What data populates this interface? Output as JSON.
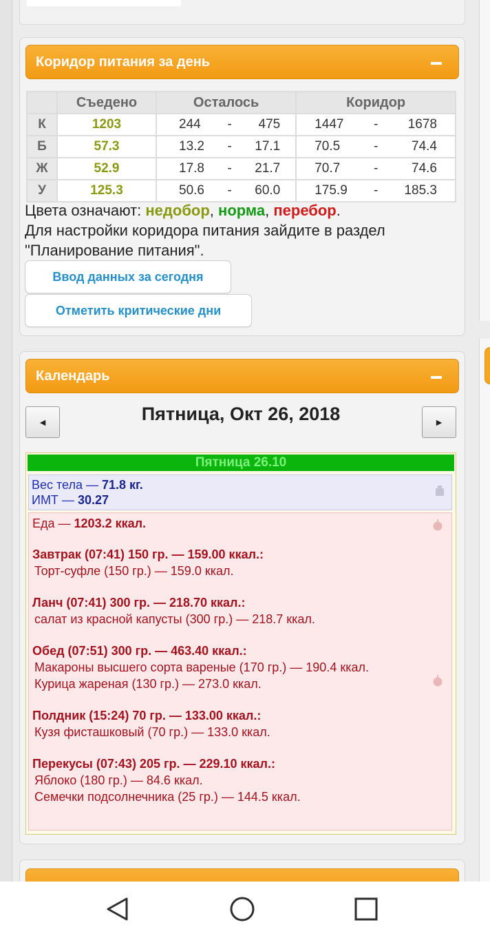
{
  "corridor": {
    "title": "Коридор питания за день",
    "collapse_label": "–",
    "columns": {
      "eaten": "Съедено",
      "remaining": "Осталось",
      "corridor": "Коридор"
    },
    "rows": [
      {
        "label": "К",
        "eaten": "1203",
        "rem_min": "244",
        "rem_max": "475",
        "cor_min": "1447",
        "cor_max": "1678"
      },
      {
        "label": "Б",
        "eaten": "57.3",
        "rem_min": "13.2",
        "rem_max": "17.1",
        "cor_min": "70.5",
        "cor_max": "74.4"
      },
      {
        "label": "Ж",
        "eaten": "52.9",
        "rem_min": "17.8",
        "rem_max": "21.7",
        "cor_min": "70.7",
        "cor_max": "74.6"
      },
      {
        "label": "У",
        "eaten": "125.3",
        "rem_min": "50.6",
        "rem_max": "60.0",
        "cor_min": "175.9",
        "cor_max": "185.3"
      }
    ],
    "dash": "-",
    "legend_prefix": "Цвета означают: ",
    "legend_under": "недобор",
    "legend_sep1": ", ",
    "legend_norm": "норма",
    "legend_sep2": ", ",
    "legend_over": "перебор",
    "legend_end": ".",
    "hint": "Для настройки коридора питания зайдите в раздел \"Планирование питания\".",
    "btn_enter_today": "Ввод данных за сегодня",
    "btn_critical_days": "Отметить критические дни",
    "colors": {
      "under": "#8a9a10",
      "norm": "#159a15",
      "over": "#d11b1b",
      "accent": "#f29a12"
    }
  },
  "calendar": {
    "title": "Календарь",
    "collapse_label": "–",
    "prev_label": "◄",
    "next_label": "►",
    "date_label": "Пятница, Окт 26, 2018",
    "day_header": "Пятница 26.10",
    "weight_label": "Вес тела — ",
    "weight_value": "71.8 кг.",
    "bmi_label": "ИМТ — ",
    "bmi_value": "30.27",
    "food_label": "Еда — ",
    "food_total": "1203.2 ккал.",
    "meals": [
      {
        "title": "Завтрак (07:41) 150 гр. — 159.00 ккал.:",
        "items": [
          "Торт-суфле (150 гр.) — 159.0 ккал."
        ]
      },
      {
        "title": "Ланч (07:41) 300 гр. — 218.70 ккал.:",
        "items": [
          "салат из красной капусты (300 гр.) — 218.7 ккал."
        ]
      },
      {
        "title": "Обед (07:51) 300 гр. — 463.40 ккал.:",
        "items": [
          "Макароны высшего сорта вареные (170 гр.) — 190.4 ккал.",
          "Курица жареная (130 гр.) — 273.0 ккал."
        ]
      },
      {
        "title": "Полдник (15:24) 70 гр. — 133.00 ккал.:",
        "items": [
          "Кузя фисташковый (70 гр.) — 133.0 ккал."
        ]
      },
      {
        "title": "Перекусы (07:43) 205 гр. — 229.10 ккал.:",
        "items": [
          "Яблоко (180 гр.) — 84.6 ккал.",
          "Семечки подсолнечника (25 гр.) — 144.5 ккал."
        ]
      }
    ]
  },
  "navbar": {
    "icons": [
      "back-icon",
      "home-icon",
      "recents-icon"
    ]
  }
}
